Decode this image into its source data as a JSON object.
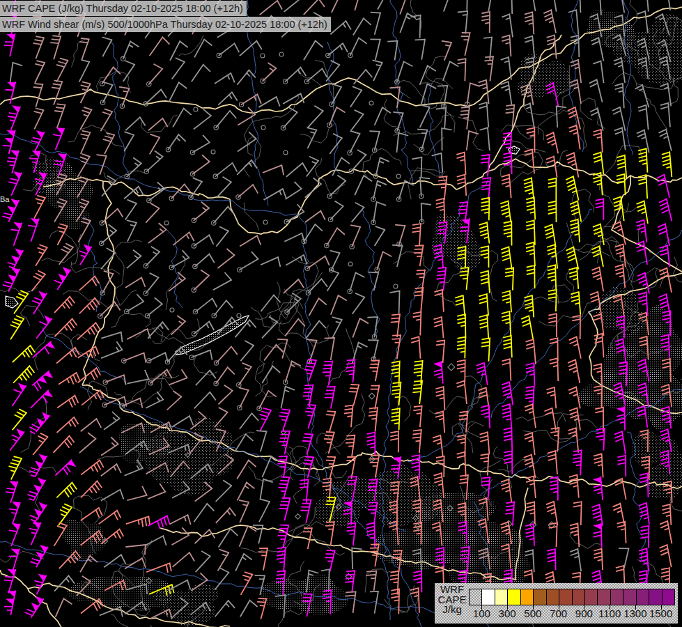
{
  "header": {
    "line1": "WRF CAPE (J/kg) Thursday 02-10-2025 18:00 (+12h)",
    "line2": "WRF Wind shear (m/s) 500/1000hPa Thursday 02-10-2025 18:00 (+12h)"
  },
  "legend": {
    "labels": [
      "WRF",
      "CAPE",
      "J/kg"
    ],
    "ticks": [
      "100",
      "300",
      "500",
      "700",
      "900",
      "1100",
      "1300",
      "1500"
    ],
    "cell_colors": [
      "none",
      "#ffffff",
      "#ffffa6",
      "#ffff00",
      "#ffa500",
      "#a25d1e",
      "#9e4f24",
      "#9b4430",
      "#983f3c",
      "#953d4c",
      "#923a5c",
      "#8f3268",
      "#8b2b70",
      "#871f78",
      "#841284",
      "#8f0a8f"
    ]
  },
  "map": {
    "background": "#000000",
    "label_fragment": "Ba",
    "barb_colors": {
      "g": "#969696",
      "r": "#bc8f8f",
      "s": "#f2837b",
      "m": "#ff00ff",
      "y": "#ffff00"
    },
    "line_colors": {
      "border": "#f2dbA6",
      "river": "#4169b8",
      "grayline": "#6f6f6f",
      "lake": "#ffffff",
      "stipple": "#cfcfcf"
    },
    "zone_grid": [
      "mrrrrgrg.g..g...g..g.g.ggggggg",
      "mrrrgrgg.g.g..g...g.grgrrggggg",
      "mrrrggrg..g..g..g.g.rgrgrggggg",
      ".rrgrg.g.g..g....g.grrgg.rgggg",
      "mrrrg.g..g..g..g..ggrrg.mrgggg",
      "mrrrrg.g....g...g.g.rgrg.sgggg",
      "mmmrrg.g..g..g...g.grgmssssggg",
      "mmmrr.g..g..g...g.g.smmsssyyyy",
      "mmrr.g..g..g..g..g.ssmsyyyyyym",
      "msrr.g...g..g...g.gsmyyyyymyym",
      "mmsr.g..g....g..g.smmyyyyyysmm",
      "msrm.g....g...g..gsmyyyyyyysmm",
      "msms..g..g...g..g.smyyyyyyssms",
      "ymss.g..g..gg..g..ssyyyyyyssmm",
      "ymss..g..g...g..gsssyyyysssmsm",
      "ymssg..g..g....g.sssyyyssssmsm",
      "ymssrgrrgrrgrmmmsyymsmsmsssmms",
      "mmssrrgrgrrrgmmssyysssmmsssmms",
      "ymsrgrrgrrgmmmsssysssmmssssmmm",
      "mssrrgrgrrggmmssmsssssmsssmmsm",
      "ymmsrgrrgrrgmmsssmmsssmssmsmsm",
      "mmysgrrgrgrgmmsmmssssmssmsmsms",
      "mmysssmrgrrgmmymmsssssmsssmsms",
      "mmsssrgrrgrgmssmmsssmssmssmsms",
      "mmsrgrsrgrgsm.m.ssgmm.sgmgs.ms",
      "mmgrsgygrgsgm.gm.smsmsmsssmsms",
      "mmrsggrggggsgmm.gssmsmsmmsmsms"
    ]
  }
}
